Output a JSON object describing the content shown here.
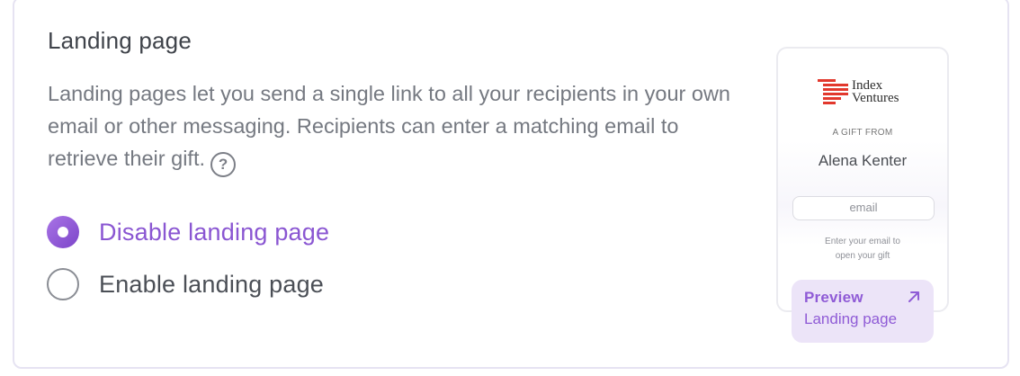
{
  "section": {
    "title": "Landing page",
    "description": "Landing pages let you send a single link to all your recipients in your own email or other messaging. Recipients can enter a matching email to retrieve their gift.",
    "help_icon": "question-circle-icon"
  },
  "options": [
    {
      "label": "Disable landing page",
      "checked": true
    },
    {
      "label": "Enable landing page",
      "checked": false
    }
  ],
  "preview": {
    "logo_line1": "Index",
    "logo_line2": "Ventures",
    "logo_color": "#e2382d",
    "gift_from": "A GIFT FROM",
    "sender_name": "Alena Kenter",
    "email_placeholder": "email",
    "hint_line1": "Enter your email to",
    "hint_line2": "open your gift",
    "button_title": "Preview",
    "button_subtitle": "Landing page",
    "button_icon": "arrow-up-right-icon"
  },
  "colors": {
    "accent": "#8a56d2",
    "button_bg": "#ece4f8"
  }
}
